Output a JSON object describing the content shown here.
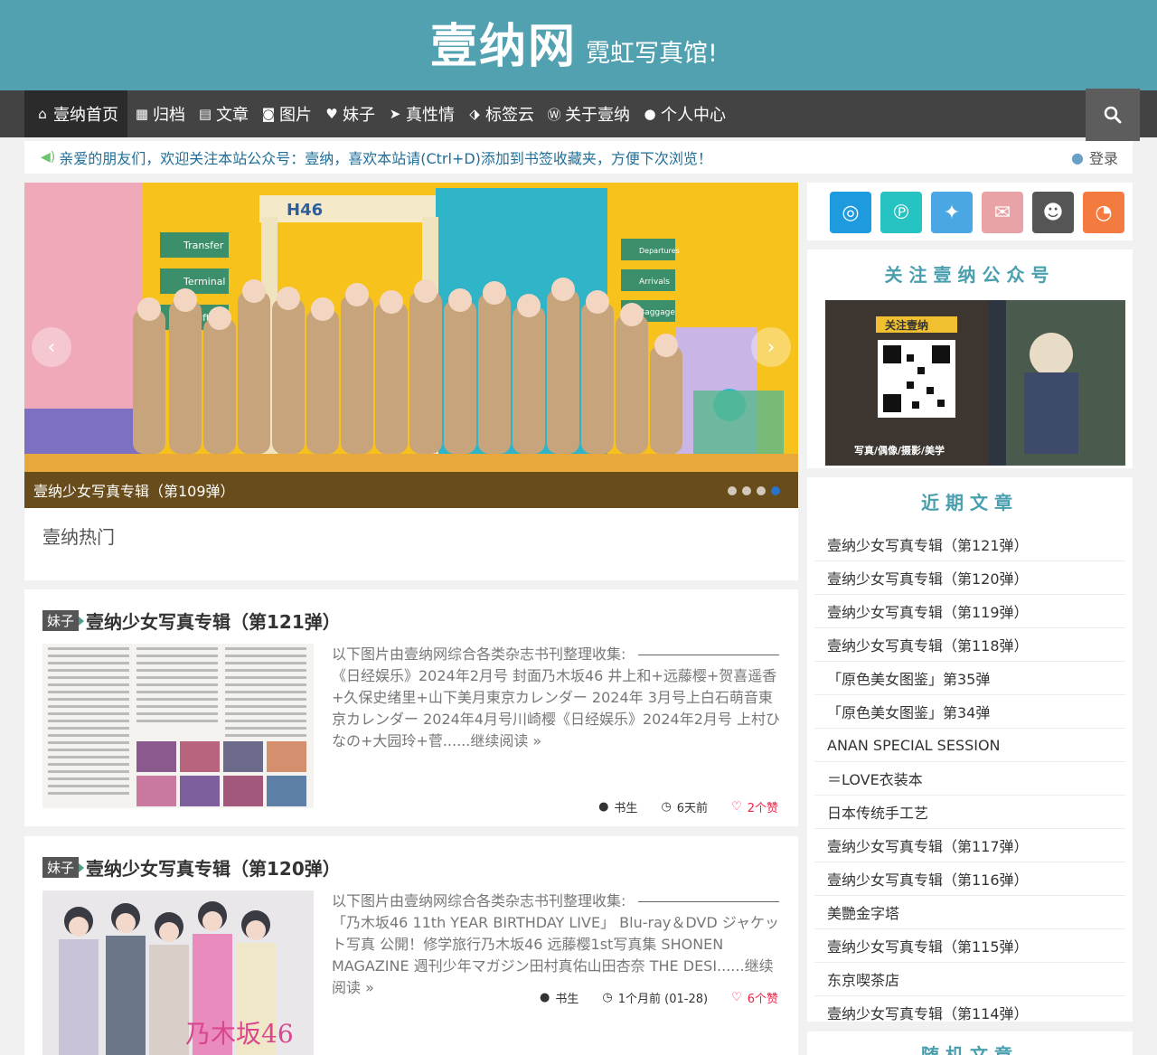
{
  "header": {
    "title": "壹纳网",
    "subtitle": "霓虹写真馆!"
  },
  "nav": {
    "items": [
      {
        "label": "壹纳首页",
        "icon": "home-icon"
      },
      {
        "label": "归档",
        "icon": "grid-icon"
      },
      {
        "label": "文章",
        "icon": "document-icon"
      },
      {
        "label": "图片",
        "icon": "camera-icon"
      },
      {
        "label": "妹子",
        "icon": "heart-icon"
      },
      {
        "label": "真性情",
        "icon": "paper-plane-icon"
      },
      {
        "label": "标签云",
        "icon": "tags-icon"
      },
      {
        "label": "关于壹纳",
        "icon": "wordpress-icon"
      },
      {
        "label": "个人中心",
        "icon": "user-icon"
      }
    ],
    "search_icon": "search-icon"
  },
  "notice": {
    "text": "亲爱的朋友们，欢迎关注本站公众号：壹纳，喜欢本站请(Ctrl+D)添加到书签收藏夹，方便下次浏览！",
    "login_label": "登录"
  },
  "slider": {
    "caption": "壹纳少女写真专辑（第109弹）",
    "signs": [
      "Transfer",
      "Terminal",
      "Lift",
      "H46",
      "Departures",
      "Arrivals",
      "Baggage"
    ],
    "slide_count": 4,
    "active_slide": 4
  },
  "hot": {
    "title": "壹纳热门"
  },
  "posts": [
    {
      "category": "妹子",
      "title": "壹纳少女写真专辑（第121弹）",
      "excerpt": "以下图片由壹纳网综合各类杂志书刊整理收集:",
      "excerpt_rest": "《日经娱乐》2024年2月号 封面乃木坂46 井上和+远藤樱+贺喜遥香+久保史绪里+山下美月東京カレンダー 2024年 3月号上白石萌音東京カレンダー 2024年4月号川崎樱《日经娱乐》2024年2月号 上村ひなの+大园玲+菅......继续阅读 »",
      "author": "书生",
      "time": "6天前",
      "likes": "2个赞"
    },
    {
      "category": "妹子",
      "title": "壹纳少女写真专辑（第120弹）",
      "excerpt": "以下图片由壹纳网综合各类杂志书刊整理收集:",
      "excerpt_rest": "「乃木坂46 11th YEAR BIRTHDAY LIVE」 Blu-ray＆DVD ジャケット写真 公開！修学旅行乃木坂46 远藤樱1st写真集 SHONEN MAGAZINE 週刊少年マガジン田村真佑山田杏奈 THE DESI......继续阅读 »",
      "thumb_text": "乃木坂46",
      "author": "书生",
      "time": "1个月前 (01-28)",
      "likes": "6个赞"
    }
  ],
  "sidebar": {
    "social": [
      {
        "name": "weibo-icon",
        "color": "#1e9bde"
      },
      {
        "name": "pinterest-icon",
        "color": "#27c2c2"
      },
      {
        "name": "twitter-icon",
        "color": "#4aa7e3"
      },
      {
        "name": "email-icon",
        "color": "#e9a2a5"
      },
      {
        "name": "qq-icon",
        "color": "#555555"
      },
      {
        "name": "rss-icon",
        "color": "#f47b3f"
      }
    ],
    "follow_title": "关注壹纳公众号",
    "qr_banner": "关注壹纳",
    "qr_tagline": "写真/偶像/摄影/美学",
    "recent_title": "近期文章",
    "recent": [
      "壹纳少女写真专辑（第121弹）",
      "壹纳少女写真专辑（第120弹）",
      "壹纳少女写真专辑（第119弹）",
      "壹纳少女写真专辑（第118弹）",
      "「原色美女图鉴」第35弹",
      "「原色美女图鉴」第34弹",
      "ANAN SPECIAL SESSION",
      "＝LOVE衣装本",
      "日本传统手工艺",
      "壹纳少女写真专辑（第117弹）",
      "壹纳少女写真专辑（第116弹）",
      "美艷金字塔",
      "壹纳少女写真专辑（第115弹）",
      "东京喫茶店",
      "壹纳少女写真专辑（第114弹）"
    ],
    "random_title": "随机文章"
  },
  "colors": {
    "header": "#52a1b1",
    "nav": "#434343",
    "accent": "#4a9fae"
  }
}
